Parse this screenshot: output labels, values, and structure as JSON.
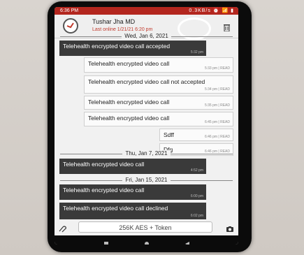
{
  "status_bar": {
    "time": "6:36 PM",
    "icons": "0.3KB/s ⏰ 📶 ▮"
  },
  "header": {
    "name": "Tushar Jha MD",
    "last_online": "Last online 1/21/21 6:20 pm"
  },
  "dates": {
    "d1": "Wed, Jan 6, 2021",
    "d2": "Thu, Jan 7, 2021",
    "d3": "Fri, Jan 15, 2021"
  },
  "messages": [
    {
      "text": "Telehealth encrypted video call accepted",
      "meta": "5:32 pm"
    },
    {
      "text": "Telehealth encrypted video call",
      "meta": "5:33 pm | READ"
    },
    {
      "text": "Telehealth encrypted video call not accepted",
      "meta": "5:34 pm | READ"
    },
    {
      "text": "Telehealth encrypted video call",
      "meta": "5:35 pm | READ"
    },
    {
      "text": "Telehealth encrypted video call",
      "meta": "6:45 pm | READ"
    },
    {
      "text": "Sdff",
      "meta": "6:46 pm | READ"
    },
    {
      "text": "Dfg",
      "meta": "6:46 pm | READ"
    },
    {
      "text": "Telehealth encrypted video call",
      "meta": "4:52 pm"
    },
    {
      "text": "Telehealth encrypted video call",
      "meta": "6:00 pm"
    },
    {
      "text": "Telehealth encrypted video call declined",
      "meta": "6:02 pm"
    }
  ],
  "composer": {
    "placeholder": "256K AES + Token"
  },
  "colors": {
    "header_bar": "#b3261e",
    "incoming": "#3a3a3a",
    "outgoing": "#fbfbfb"
  }
}
